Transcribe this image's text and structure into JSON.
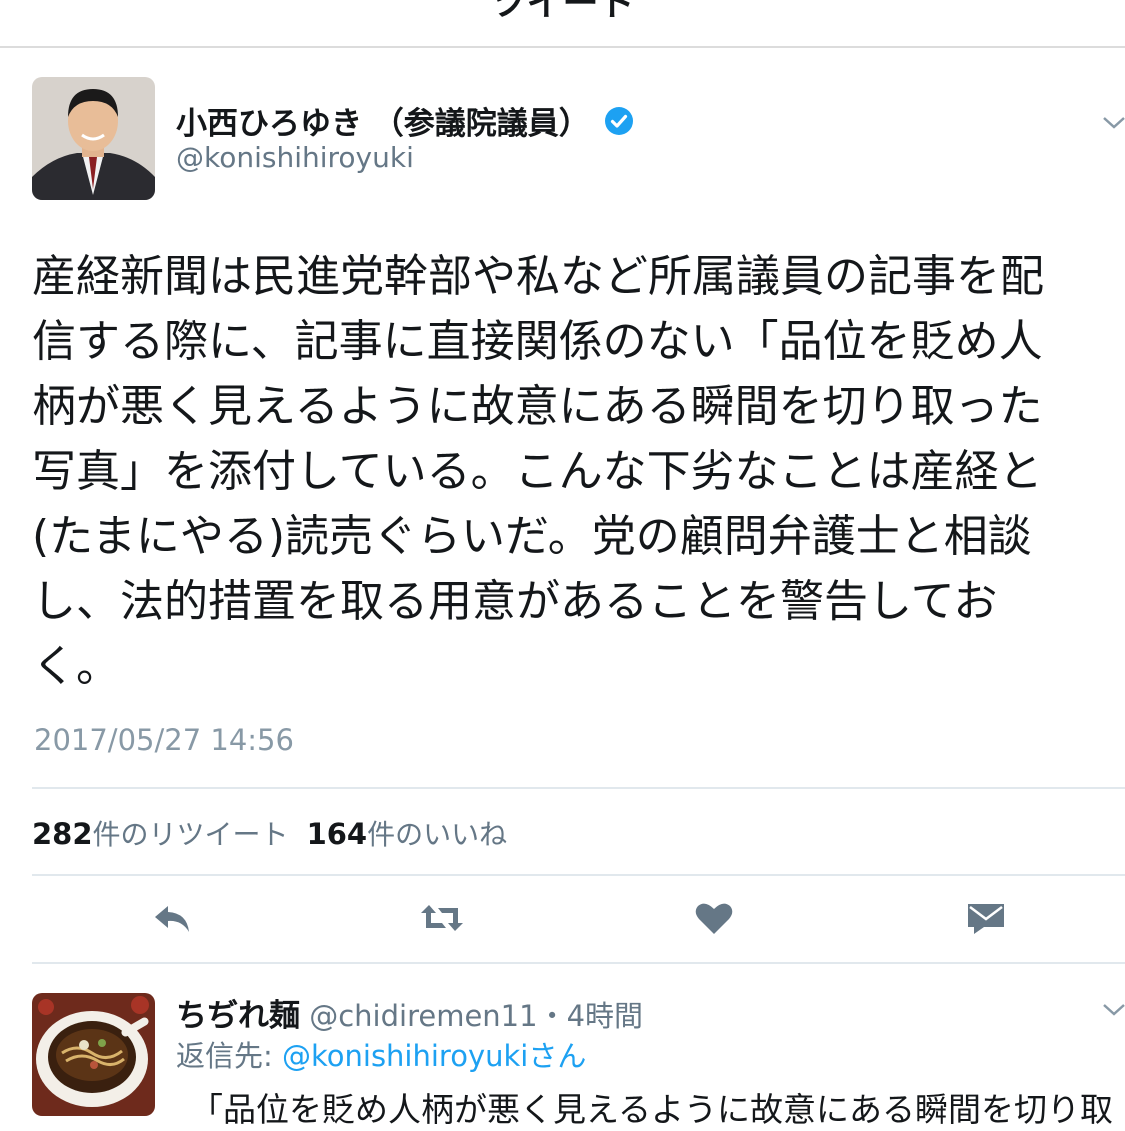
{
  "nav": {
    "title": "ツイート"
  },
  "tweet": {
    "author_name": "小西ひろゆき （参議院議員）",
    "author_handle": "@konishihiroyuki",
    "text_lines": [
      "産経新聞は民進党幹部や私など所属議員の記事を配",
      "信する際に、記事に直接関係のない「品位を貶め人",
      "柄が悪く見えるように故意にある瞬間を切り取った",
      "写真」を添付している。こんな下劣なことは産経と",
      "(たまにやる)読売ぐらいだ。党の顧問弁護士と相談",
      "し、法的措置を取る用意があることを警告してお",
      "く。"
    ],
    "timestamp": "2017/05/27 14:56",
    "retweet_count": "282",
    "retweet_label": "件のリツイート",
    "like_count": "164",
    "like_label": "件のいいね"
  },
  "actions": [
    "reply-icon",
    "retweet-icon",
    "like-icon",
    "dm-icon"
  ],
  "reply": {
    "name": "ちぢれ麺",
    "handle_time": "@chidiremen11・4時間",
    "reply_to_prefix": "返信先: ",
    "reply_to_mention": "@konishihiroyukiさん",
    "text": "「品位を貶め人柄が悪く見えるように故意にある瞬間を切り取"
  },
  "colors": {
    "verified": "#1da1f2",
    "icon": "#657786",
    "link": "#1da1f2"
  }
}
